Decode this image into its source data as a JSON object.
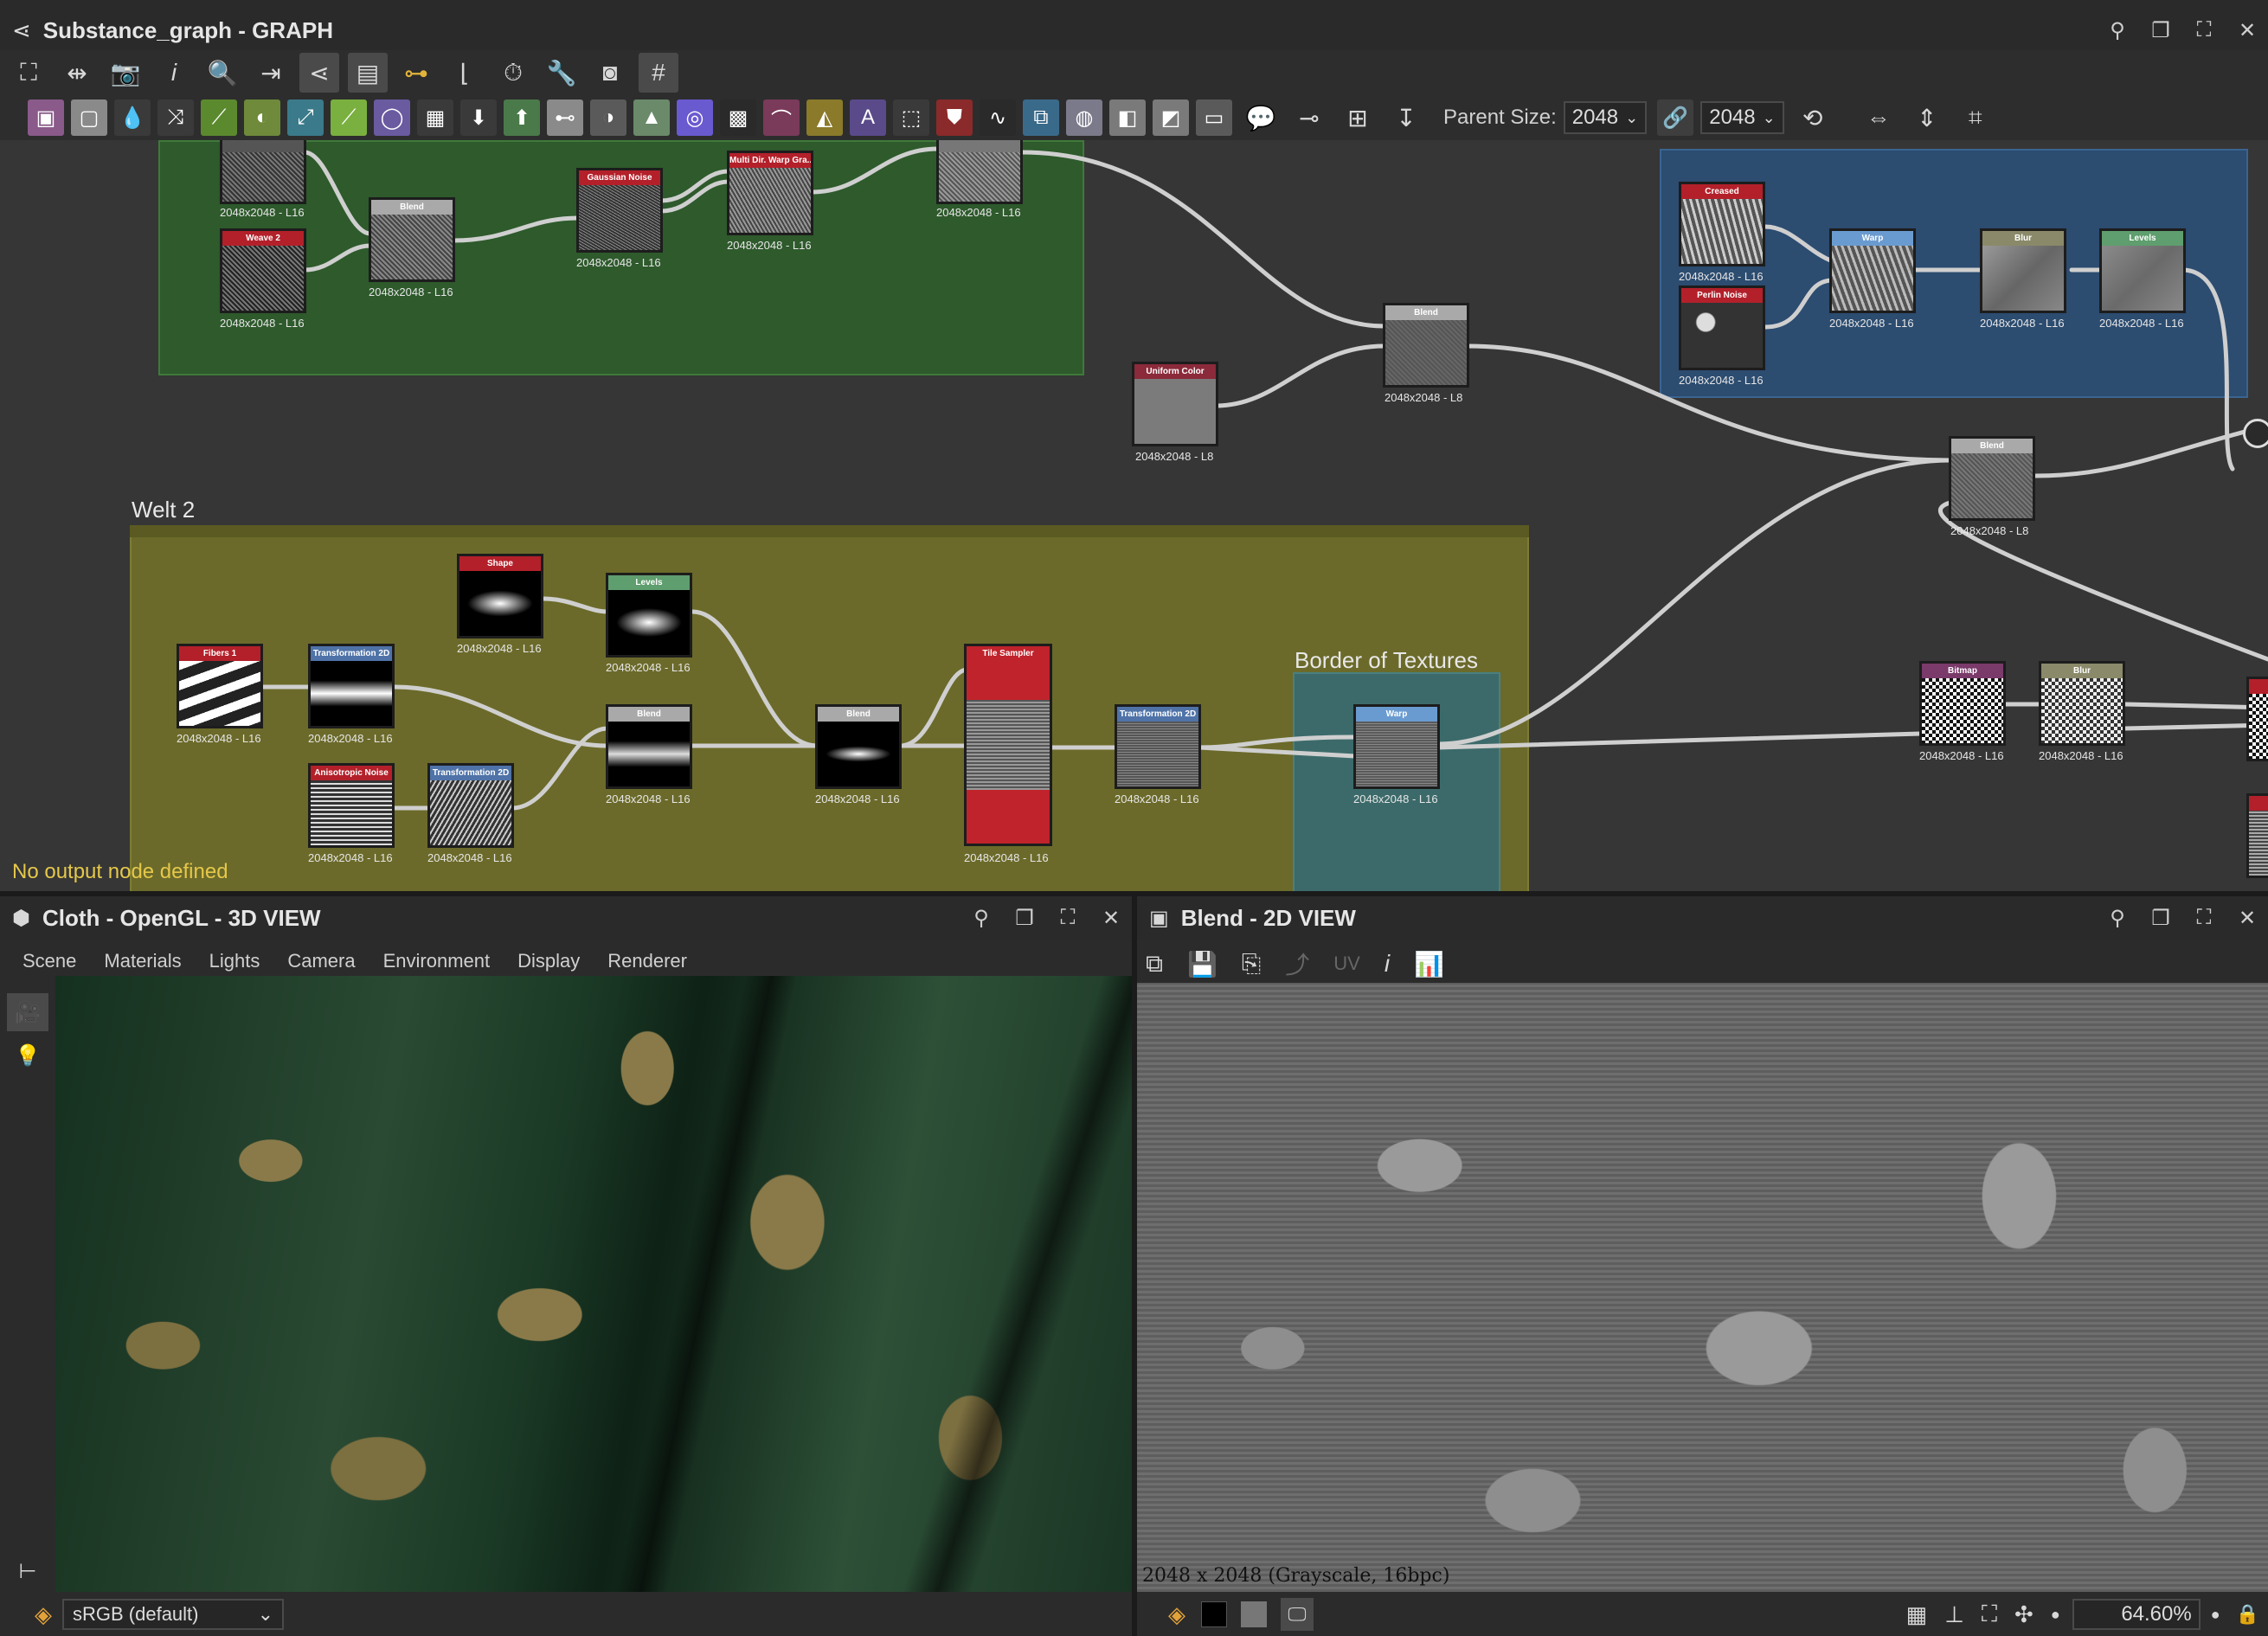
{
  "graph_panel": {
    "title": "Substance_graph - GRAPH",
    "parent_size_label": "Parent Size:",
    "parent_size_value": "2048",
    "size_value": "2048",
    "status_message": "No output node defined",
    "frames": [
      {
        "id": "green",
        "label": ""
      },
      {
        "id": "blue",
        "label": ""
      },
      {
        "id": "welt2",
        "label": "Welt 2"
      },
      {
        "id": "border",
        "label": "Border of Textures"
      }
    ],
    "nodes": [
      {
        "title": "",
        "caption": "2048x2048 - L16",
        "header_color": "#555555",
        "thumb": "noise"
      },
      {
        "title": "Weave 2",
        "caption": "2048x2048 - L16",
        "header_color": "#b3202a",
        "thumb": "noise"
      },
      {
        "title": "Blend",
        "caption": "2048x2048 - L16",
        "header_color": "#a9a9a9",
        "thumb": "noise"
      },
      {
        "title": "Gaussian Noise",
        "caption": "2048x2048 - L16",
        "header_color": "#b3202a",
        "thumb": "noise"
      },
      {
        "title": "Multi Dir. Warp Gra...",
        "caption": "2048x2048 - L16",
        "header_color": "#b3202a",
        "thumb": "noise"
      },
      {
        "title": "",
        "caption": "2048x2048 - L16",
        "header_color": "#777777",
        "thumb": "noise"
      },
      {
        "title": "Uniform Color",
        "caption": "2048x2048 - L8",
        "header_color": "#8b2a3a",
        "thumb": "flat"
      },
      {
        "title": "Blend",
        "caption": "2048x2048 - L8",
        "header_color": "#a9a9a9",
        "thumb": "noise"
      },
      {
        "title": "Creased",
        "caption": "2048x2048 - L16",
        "header_color": "#b3202a",
        "thumb": "wave"
      },
      {
        "title": "Perlin Noise",
        "caption": "2048x2048 - L16",
        "header_color": "#b3202a",
        "thumb": "blob"
      },
      {
        "title": "Warp",
        "caption": "2048x2048 - L16",
        "header_color": "#6a9bd0",
        "thumb": "wave"
      },
      {
        "title": "Blur",
        "caption": "2048x2048 - L16",
        "header_color": "#8a8a6a",
        "thumb": "soft"
      },
      {
        "title": "Levels",
        "caption": "2048x2048 - L16",
        "header_color": "#5f9e6e",
        "thumb": "soft"
      },
      {
        "title": "Blend",
        "caption": "2048x2048 - L8",
        "header_color": "#a9a9a9",
        "thumb": "noise"
      },
      {
        "title": "Shape",
        "caption": "2048x2048 - L16",
        "header_color": "#b3202a",
        "thumb": "spot"
      },
      {
        "title": "Levels",
        "caption": "2048x2048 - L16",
        "header_color": "#5f9e6e",
        "thumb": "spot"
      },
      {
        "title": "Fibers 1",
        "caption": "2048x2048 - L16",
        "header_color": "#b3202a",
        "thumb": "fibers"
      },
      {
        "title": "Transformation 2D",
        "caption": "2048x2048 - L16",
        "header_color": "#4f73a8",
        "thumb": "band"
      },
      {
        "title": "Blend",
        "caption": "2048x2048 - L16",
        "header_color": "#a9a9a9",
        "thumb": "band"
      },
      {
        "title": "Blend",
        "caption": "2048x2048 - L16",
        "header_color": "#a9a9a9",
        "thumb": "spot"
      },
      {
        "title": "Anisotropic Noise",
        "caption": "2048x2048 - L16",
        "header_color": "#b3202a",
        "thumb": "lines"
      },
      {
        "title": "Transformation 2D",
        "caption": "2048x2048 - L16",
        "header_color": "#4f73a8",
        "thumb": "diag"
      },
      {
        "title": "Tile Sampler",
        "caption": "2048x2048 - L16",
        "header_color": "#c0232b",
        "thumb": "tile"
      },
      {
        "title": "Transformation 2D",
        "caption": "2048x2048 - L16",
        "header_color": "#4f73a8",
        "thumb": "noise"
      },
      {
        "title": "Warp",
        "caption": "2048x2048 - L16",
        "header_color": "#6a9bd0",
        "thumb": "noise"
      },
      {
        "title": "Bitmap",
        "caption": "2048x2048 - L16",
        "header_color": "#7a3a6a",
        "thumb": "bw"
      },
      {
        "title": "Blur",
        "caption": "2048x2048 - L16",
        "header_color": "#8a8a6a",
        "thumb": "bw"
      }
    ]
  },
  "view3d": {
    "title": "Cloth - OpenGL - 3D VIEW",
    "menus": [
      "Scene",
      "Materials",
      "Lights",
      "Camera",
      "Environment",
      "Display",
      "Renderer"
    ],
    "colorspace": "sRGB (default)"
  },
  "view2d": {
    "title": "Blend - 2D VIEW",
    "uv_label": "UV",
    "image_info": "2048 x 2048 (Grayscale, 16bpc)",
    "zoom": "64.60%"
  },
  "colors": {
    "green_frame": "#2e5a2c",
    "blue_frame": "#2c4c70",
    "yellow_frame": "#6b6a2a",
    "teal_frame": "#3c6a6a",
    "accent_red": "#b3202a",
    "status_yellow": "#e5c84a"
  }
}
